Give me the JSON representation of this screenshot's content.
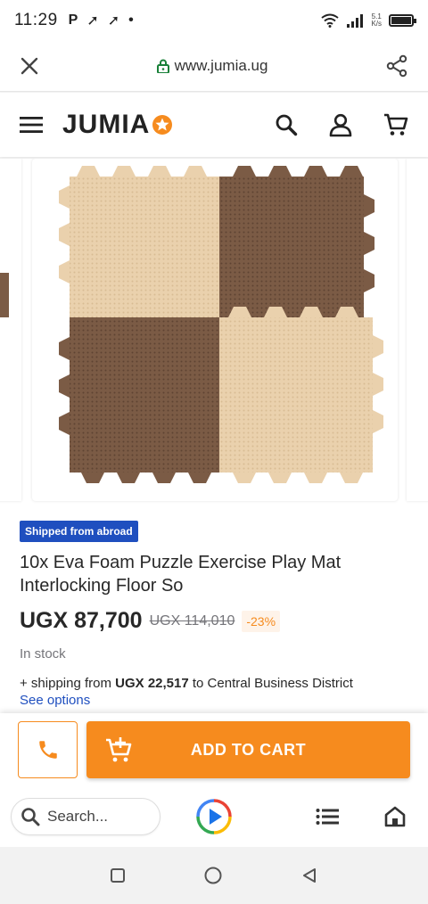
{
  "status_bar": {
    "time": "11:29",
    "app_icons": [
      "P",
      "➚",
      "➚",
      "•"
    ],
    "net_speed_value": "5.1",
    "net_speed_unit": "K/s"
  },
  "browser": {
    "url": "www.jumia.ug"
  },
  "header": {
    "logo_text": "JUMIA"
  },
  "product": {
    "badge": "Shipped from abroad",
    "title": "10x Eva Foam Puzzle Exercise Play Mat Interlocking Floor So",
    "price": "UGX 87,700",
    "old_price": "UGX 114,010",
    "discount": "-23%",
    "stock": "In stock",
    "shipping_prefix": "+ shipping from ",
    "shipping_amount": "UGX 22,517",
    "shipping_suffix": " to Central Business District",
    "see_options": "See options"
  },
  "cta": {
    "add_to_cart": "ADD TO CART"
  },
  "bottom_bar": {
    "search_placeholder": "Search..."
  },
  "colors": {
    "accent": "#f68b1e",
    "badge_blue": "#1f4fbf",
    "tile_beige": "#ead1ad",
    "tile_brown": "#7b5b45"
  }
}
